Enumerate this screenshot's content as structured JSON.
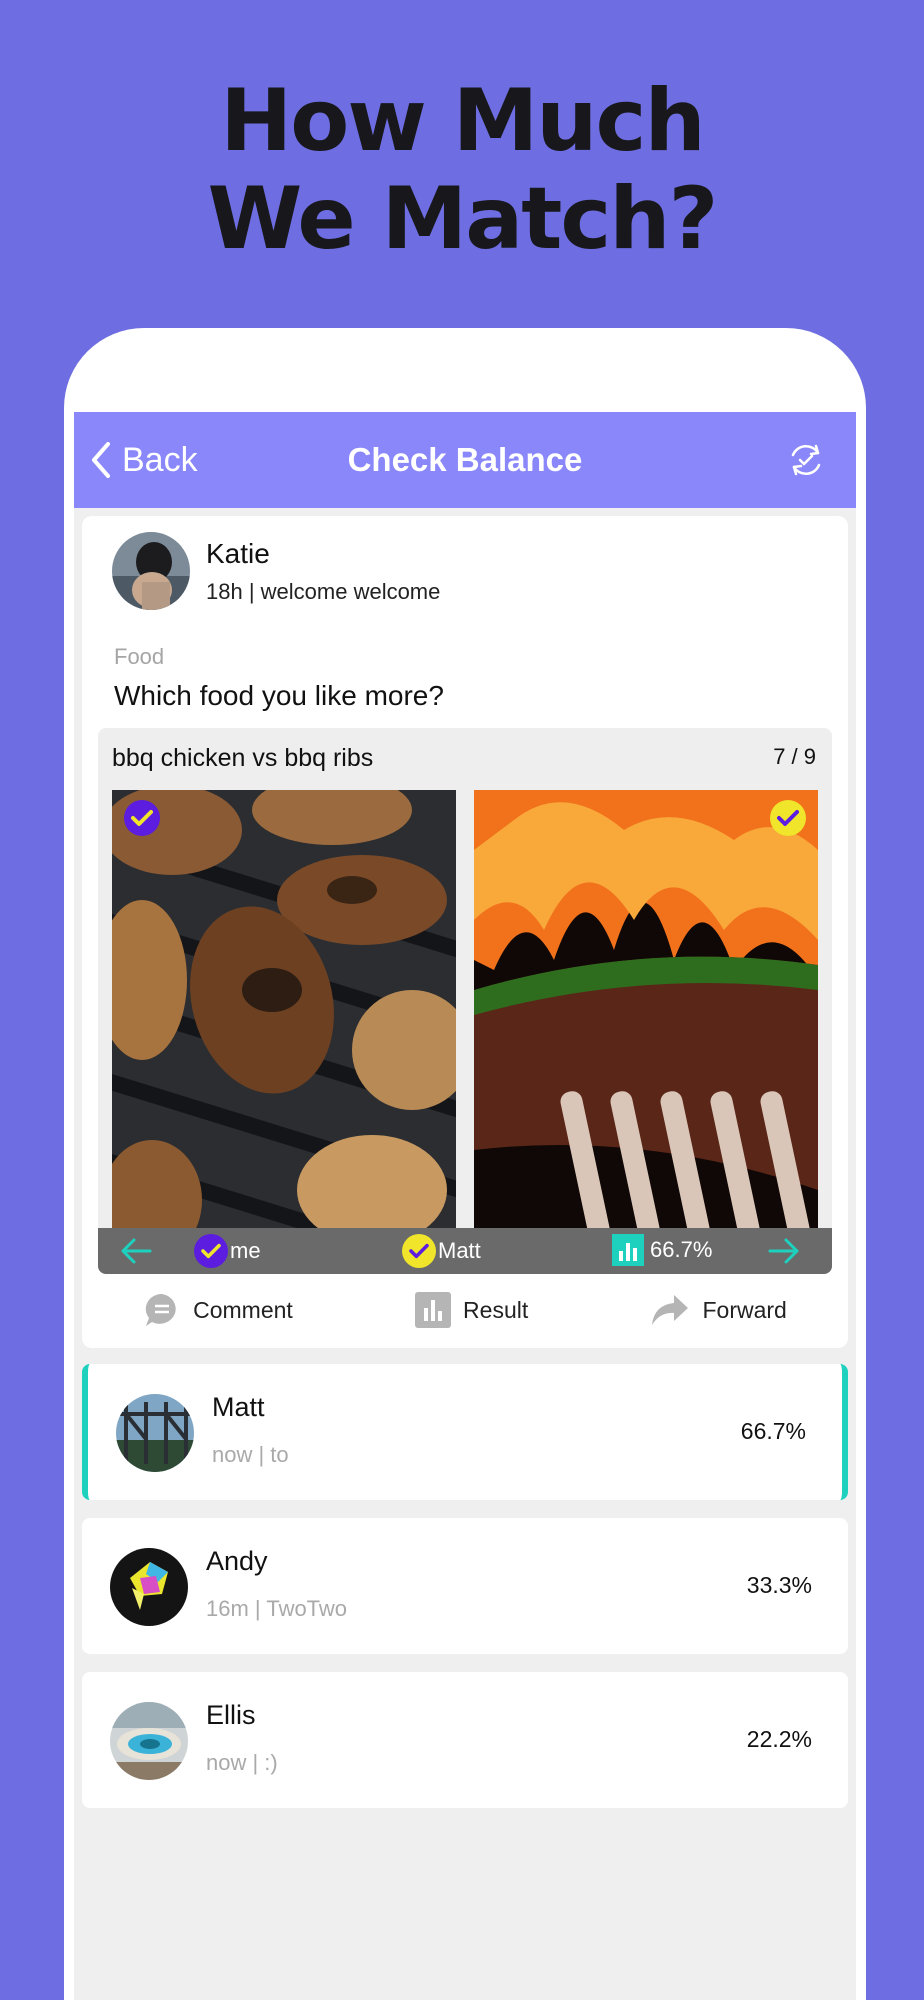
{
  "headline": {
    "line1": "How Much",
    "line2": "We Match?"
  },
  "navbar": {
    "back_label": "Back",
    "title": "Check Balance"
  },
  "post": {
    "author": "Katie",
    "meta": "18h | welcome welcome",
    "category": "Food",
    "question": "Which food you like more?",
    "comparison": {
      "title": "bbq chicken vs bbq ribs",
      "counter": "7 / 9",
      "votes": [
        {
          "label": "me",
          "color": "#5c1de0"
        },
        {
          "label": "Matt",
          "color": "#f0e52a"
        }
      ],
      "match_percent": "66.7%"
    },
    "actions": {
      "comment": "Comment",
      "result": "Result",
      "forward": "Forward"
    }
  },
  "matches": [
    {
      "name": "Matt",
      "meta": "now | to",
      "percent": "66.7%"
    },
    {
      "name": "Andy",
      "meta": "16m | TwoTwo",
      "percent": "33.3%"
    },
    {
      "name": "Ellis",
      "meta": "now | :)",
      "percent": "22.2%"
    }
  ],
  "colors": {
    "background": "#6e6ee2",
    "navbar": "#8a87fb",
    "accent": "#1ed1be"
  }
}
